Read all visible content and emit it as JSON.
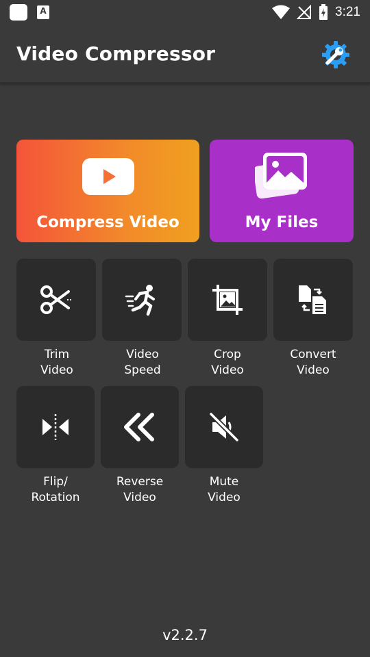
{
  "status_bar": {
    "time": "3:21",
    "notification_icon_letter": "A"
  },
  "app_bar": {
    "title": "Video Compressor",
    "settings_icon": "settings-wrench-icon"
  },
  "cards": {
    "compress": {
      "label": "Compress Video",
      "icon": "play-icon"
    },
    "files": {
      "label": "My Files",
      "icon": "gallery-icon"
    }
  },
  "tools": {
    "trim": {
      "label": "Trim\nVideo",
      "icon": "scissors-icon"
    },
    "speed": {
      "label": "Video\nSpeed",
      "icon": "running-icon"
    },
    "crop": {
      "label": "Crop\nVideo",
      "icon": "crop-icon"
    },
    "convert": {
      "label": "Convert\nVideo",
      "icon": "convert-icon"
    },
    "flip": {
      "label": "Flip/\nRotation",
      "icon": "flip-icon"
    },
    "reverse": {
      "label": "Reverse\nVideo",
      "icon": "double-chevron-left-icon"
    },
    "mute": {
      "label": "Mute\nVideo",
      "icon": "mute-icon"
    }
  },
  "footer": {
    "version": "v2.2.7"
  },
  "colors": {
    "background": "#3a3a3a",
    "tile": "#2b2b2b",
    "compress_gradient_start": "#f4543a",
    "compress_gradient_end": "#f0a020",
    "files_purple": "#a82fc8",
    "settings_blue": "#2a9df4"
  }
}
